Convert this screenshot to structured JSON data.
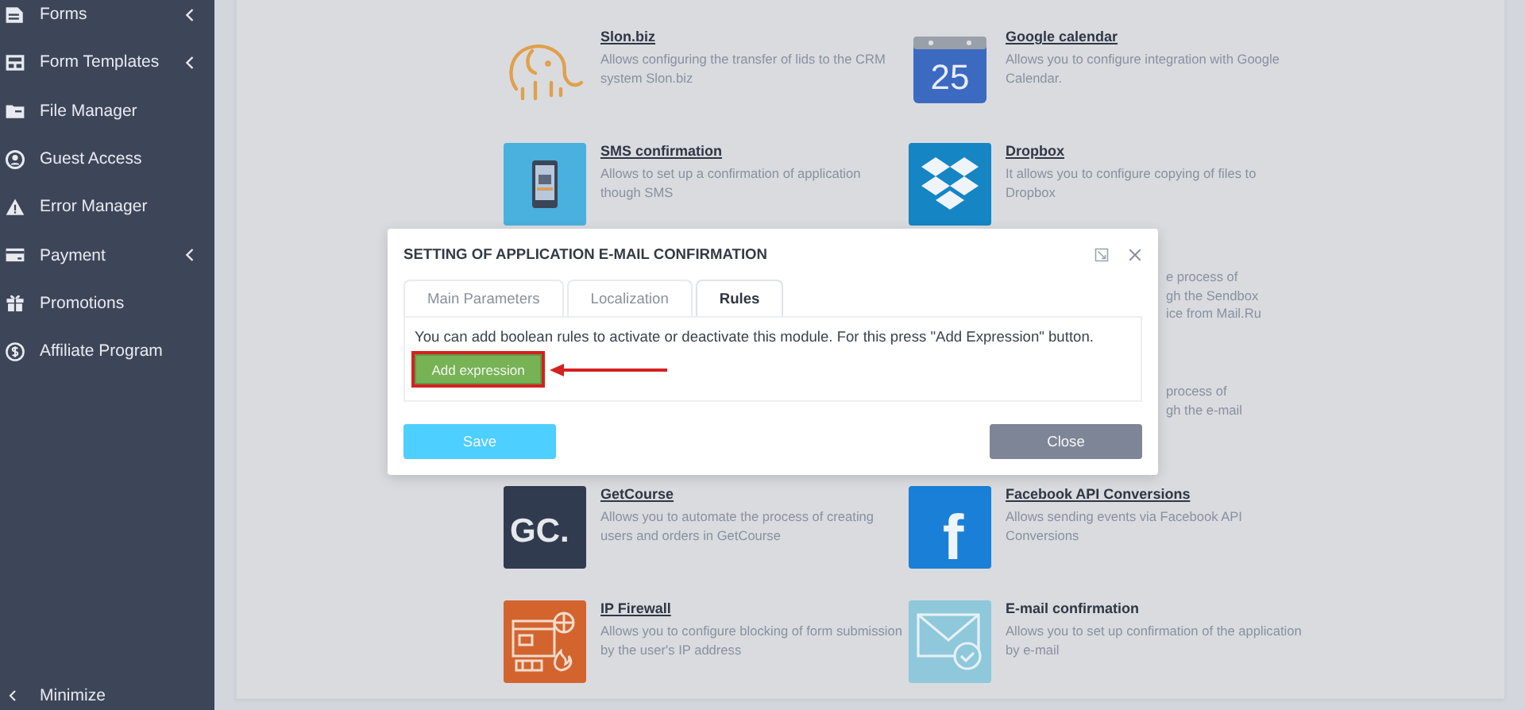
{
  "sidebar": {
    "items": [
      {
        "label": "Forms",
        "expandable": true
      },
      {
        "label": "Form Templates",
        "expandable": true
      },
      {
        "label": "File Manager",
        "expandable": false
      },
      {
        "label": "Guest Access",
        "expandable": false
      },
      {
        "label": "Error Manager",
        "expandable": false
      },
      {
        "label": "Payment",
        "expandable": true
      },
      {
        "label": "Promotions",
        "expandable": false
      },
      {
        "label": "Affiliate Program",
        "expandable": false
      }
    ],
    "minimize": "Minimize"
  },
  "modules": [
    {
      "kind": "card",
      "title": "Slon.biz",
      "link": true,
      "description": "Allows configuring the transfer of lids to the CRM system Slon.biz"
    },
    {
      "kind": "card",
      "logo_text": "25",
      "title": "Google calendar",
      "link": true,
      "description": "Allows you to configure integration with Google Calendar."
    },
    {
      "kind": "card",
      "title": "SMS confirmation",
      "link": true,
      "description": "Allows to set up a confirmation of application though SMS"
    },
    {
      "kind": "card",
      "title": "Dropbox",
      "link": true,
      "description": "It allows you to configure copying of files to Dropbox"
    },
    {
      "kind": "covered"
    },
    {
      "kind": "covered",
      "visible_lines": [
        "e process of",
        "gh the Sendbox",
        "ice from Mail.Ru"
      ]
    },
    {
      "kind": "covered"
    },
    {
      "kind": "covered",
      "visible_lines": [
        "process of",
        "gh the e-mail"
      ]
    },
    {
      "kind": "card",
      "logo_text": "GC.",
      "title": "GetCourse",
      "link": true,
      "description": "Allows you to automate the process of creating users and orders in GetCourse"
    },
    {
      "kind": "card",
      "logo_text": "f",
      "title": "Facebook API Conversions",
      "link": true,
      "description": "Allows sending events via Facebook API Conversions"
    },
    {
      "kind": "card",
      "title": "IP Firewall",
      "link": true,
      "description": "Allows you to configure blocking of form submission by the user's IP address"
    },
    {
      "kind": "card",
      "title": "E-mail confirmation",
      "link": false,
      "description": "Allows you to set up confirmation of the application by e-mail"
    }
  ],
  "dialog": {
    "title": "SETTING OF APPLICATION E-MAIL CONFIRMATION",
    "tabs": [
      {
        "label": "Main Parameters",
        "selected": false
      },
      {
        "label": "Localization",
        "selected": false
      },
      {
        "label": "Rules",
        "selected": true
      }
    ],
    "message": "You can add boolean rules to activate or deactivate this module. For this press \"Add Expression\" button.",
    "add_button": {
      "label": "Add expression",
      "highlighted": true
    },
    "buttons": [
      {
        "label": "Save",
        "kind": "primary"
      },
      {
        "label": "Close",
        "kind": "secondary"
      }
    ]
  }
}
